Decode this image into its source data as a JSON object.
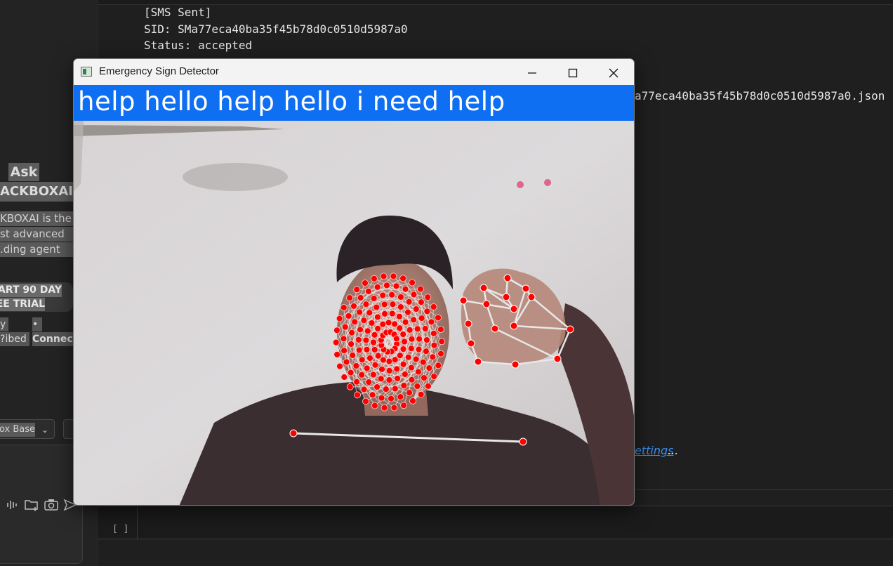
{
  "terminal": {
    "lines": [
      "[SMS Sent]",
      "SID: SMa77eca40ba35f45b78d0c0510d5987a0",
      "Status: accepted"
    ],
    "json_fragment": "a77eca40ba35f45b78d0c0510d5987a0.json",
    "settings_link": "ettings",
    "settings_suffix": "...",
    "cell_brackets": "[ ]"
  },
  "side_panel": {
    "ask_title": "Ask",
    "brand": "ACKBOXAI",
    "description_lines": [
      "KBOXAI is the",
      "st advanced",
      "ding agent."
    ],
    "trial_lines": [
      "ART 90 DAY",
      "EE TRIAL"
    ],
    "footer_left_1": "y",
    "footer_bullet": "•",
    "footer_left_2": "ibed?",
    "footer_connect": "Connec",
    "model_select": "ox Base",
    "icons": [
      "waveform-icon",
      "folder-add-icon",
      "camera-icon",
      "send-icon"
    ]
  },
  "window": {
    "title": "Emergency Sign Detector",
    "controls": {
      "minimize": "—",
      "maximize": "☐",
      "close": "✕"
    },
    "banner_text": "help hello help hello i need help",
    "banner_color": "#0f6ff2"
  },
  "colors": {
    "landmark": "#ff0000",
    "connection": "#e8e8e8",
    "terminal_bg": "#1f1f1f"
  }
}
